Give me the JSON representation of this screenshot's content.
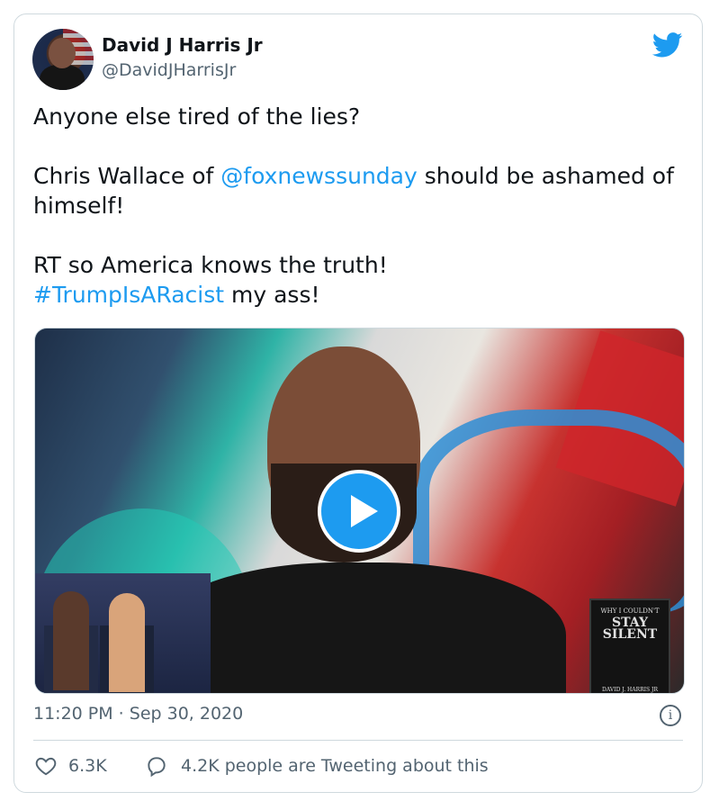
{
  "author": {
    "name": "David J Harris Jr",
    "handle": "@DavidJHarrisJr"
  },
  "tweet": {
    "line1": "Anyone else tired of the lies?",
    "line2_prefix": "Chris Wallace of ",
    "mention": "@foxnewssunday",
    "line2_suffix": " should be ashamed of himself!",
    "line3": "RT so America knows the truth!",
    "hashtag": "#TrumpIsARacist",
    "line4_suffix": " my ass!"
  },
  "media": {
    "book_top": "WHY I COULDN'T",
    "book_title": "STAY SILENT",
    "book_author": "DAVID J. HARRIS JR"
  },
  "meta": {
    "timestamp": "11:20 PM · Sep 30, 2020"
  },
  "engagement": {
    "likes": "6.3K",
    "conversation": "4.2K people are Tweeting about this"
  },
  "icons": {
    "bird": "twitter-bird-icon",
    "play": "play-icon",
    "info": "info-icon",
    "heart": "heart-icon",
    "reply": "reply-bubble-icon"
  },
  "colors": {
    "accent": "#1d9bf0",
    "secondary_text": "#536471",
    "border": "#cfd9de"
  }
}
